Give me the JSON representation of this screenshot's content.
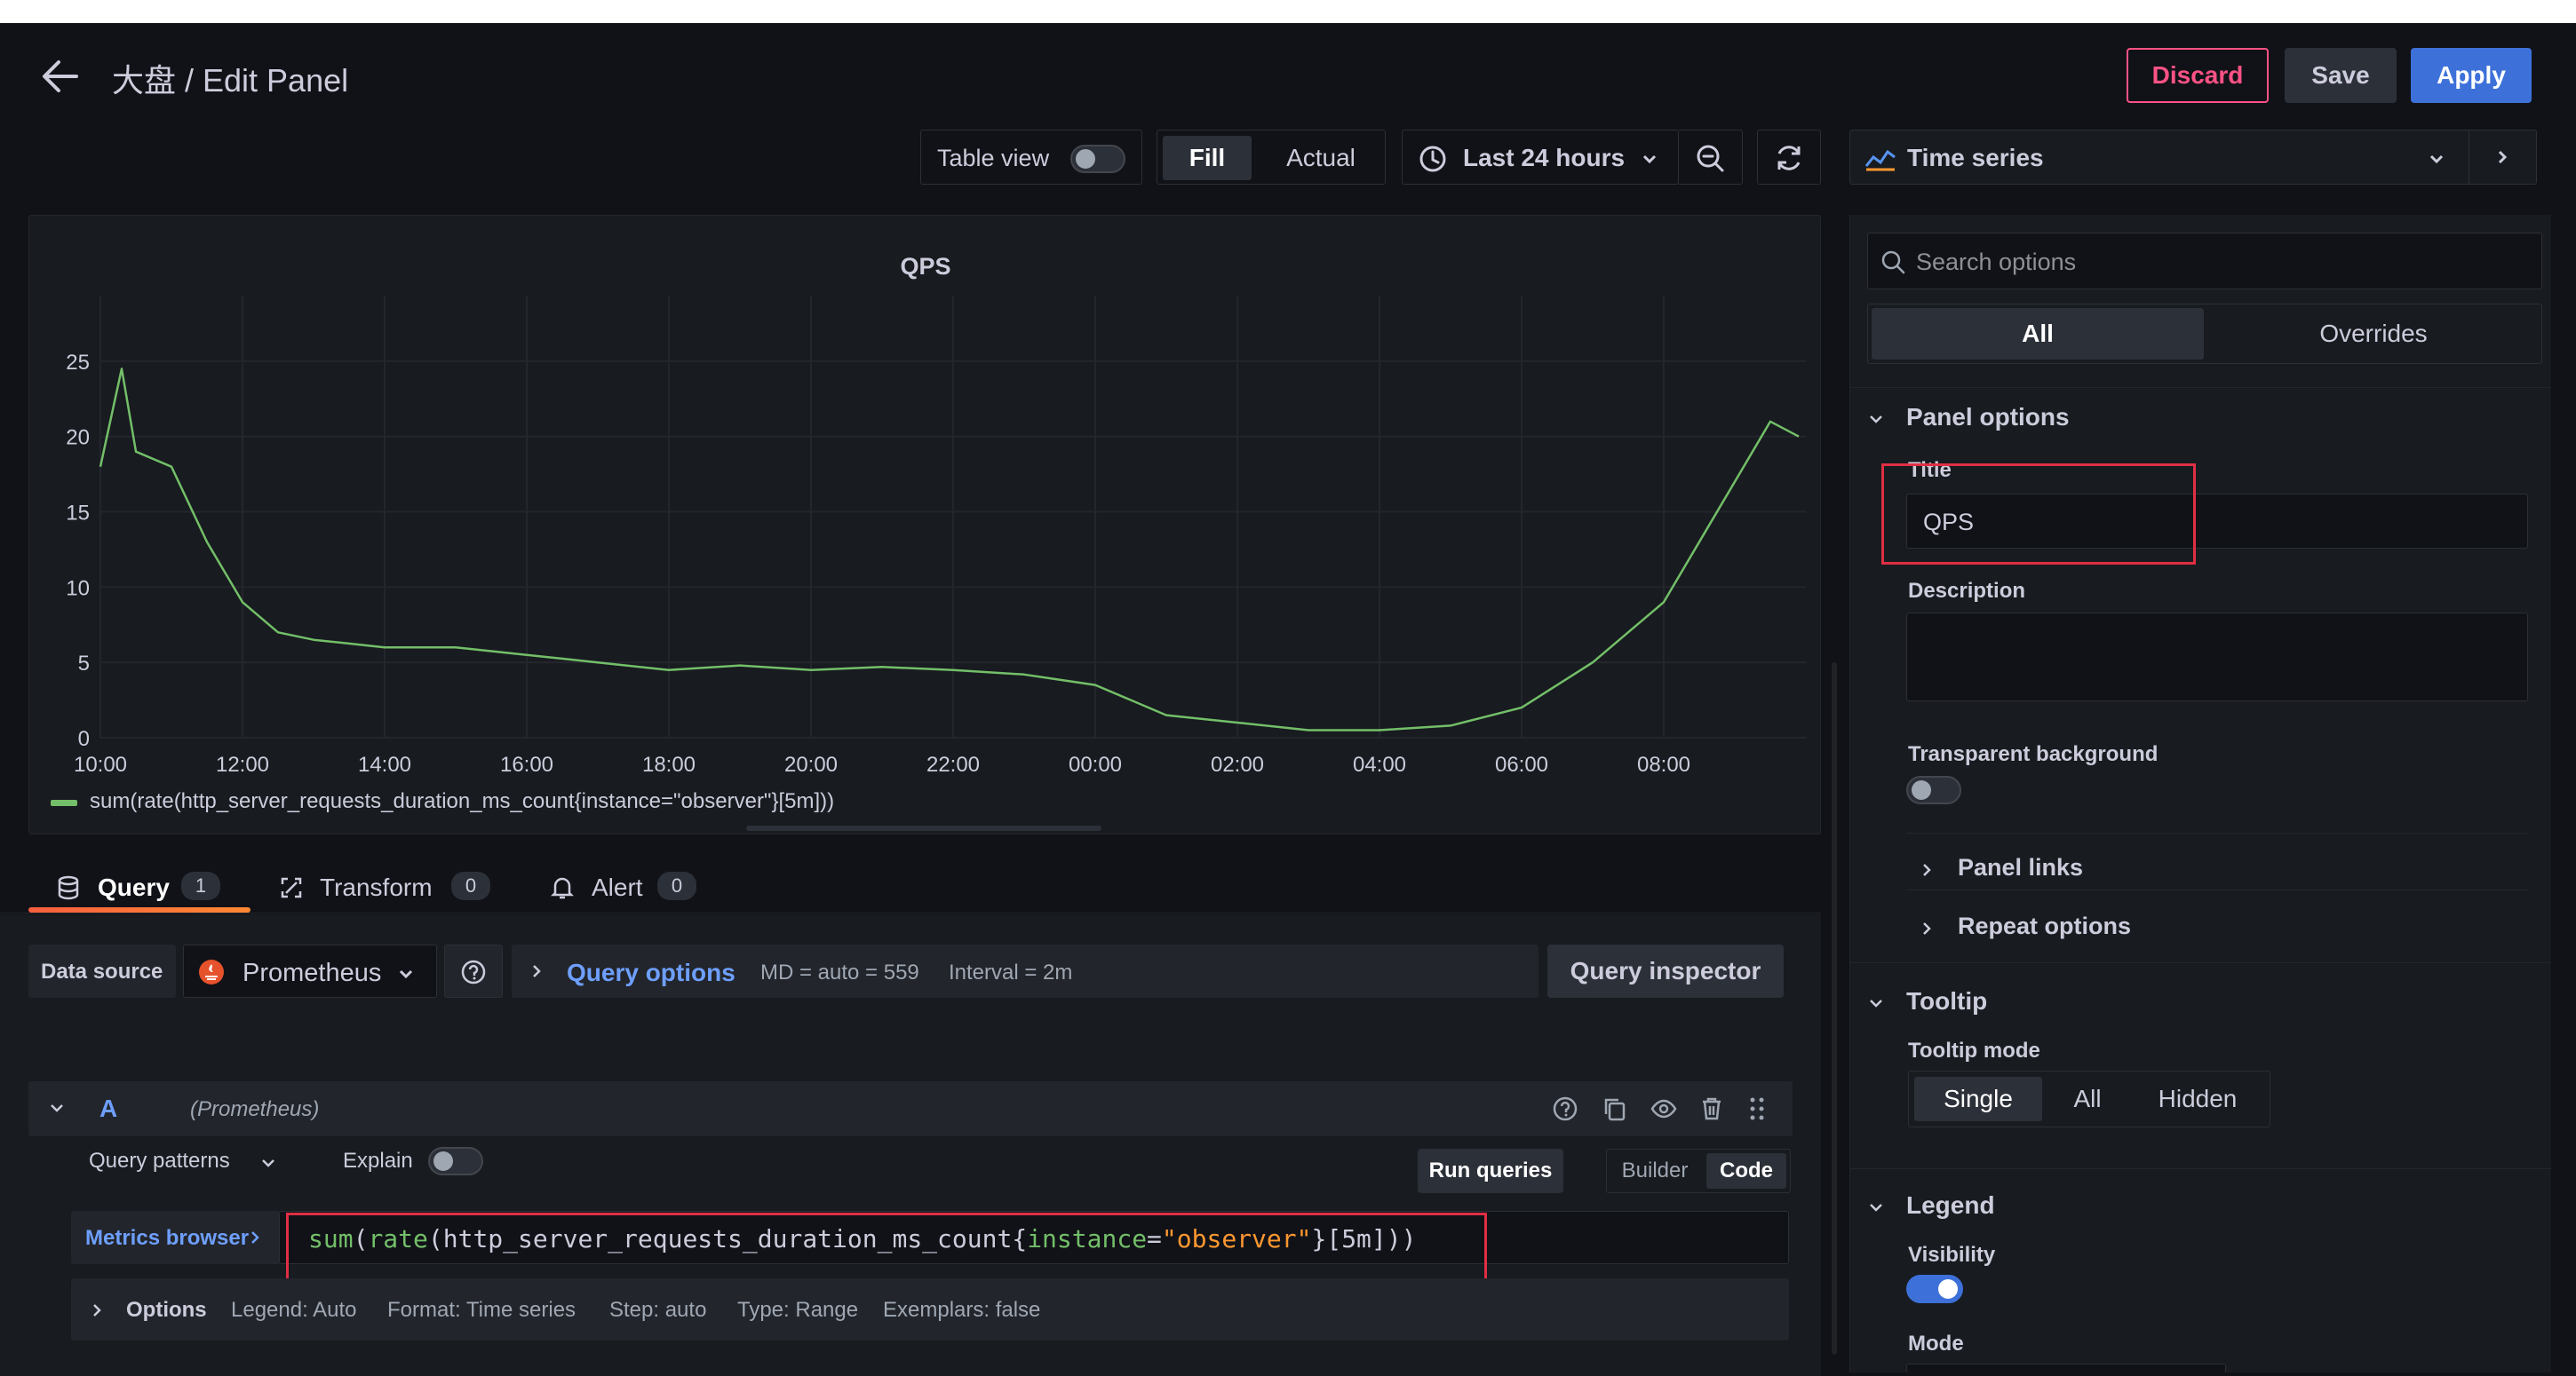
{
  "header": {
    "back_label": "←",
    "title": "大盘 / Edit Panel",
    "discard_label": "Discard",
    "save_label": "Save",
    "apply_label": "Apply"
  },
  "toolbar": {
    "table_view_label": "Table view",
    "fill_label": "Fill",
    "actual_label": "Actual",
    "time_range": "Last 24 hours",
    "visualization": "Time series"
  },
  "chart_data": {
    "type": "line",
    "title": "QPS",
    "xlabel": "",
    "ylabel": "",
    "ylim": [
      0,
      27
    ],
    "y_ticks": [
      0,
      5,
      10,
      15,
      20,
      25
    ],
    "x_tick_labels": [
      "10:00",
      "12:00",
      "14:00",
      "16:00",
      "18:00",
      "20:00",
      "22:00",
      "00:00",
      "02:00",
      "04:00",
      "06:00",
      "08:00"
    ],
    "x_hours_since_start": [
      0.0,
      0.3,
      0.5,
      1.0,
      1.5,
      2.0,
      2.5,
      3.0,
      4.0,
      5.0,
      6.0,
      7.0,
      8.0,
      9.0,
      10.0,
      11.0,
      12.0,
      13.0,
      14.0,
      15.0,
      16.0,
      17.0,
      18.0,
      19.0,
      20.0,
      21.0,
      22.0,
      23.0,
      23.5,
      23.9
    ],
    "series": [
      {
        "name": "sum(rate(http_server_requests_duration_ms_count{instance=\"observer\"}[5m]))",
        "color": "#73bf69",
        "values": [
          18,
          24.5,
          19,
          18,
          13,
          9,
          7,
          6.5,
          6,
          6,
          5.5,
          5,
          4.5,
          4.8,
          4.5,
          4.7,
          4.5,
          4.2,
          3.5,
          1.5,
          1.0,
          0.5,
          0.5,
          0.8,
          2.0,
          5.0,
          9.0,
          17.0,
          21.0,
          20.0
        ]
      }
    ],
    "legend": "bottom-left",
    "grid": true
  },
  "query_tabs": [
    {
      "label": "Query",
      "count": "1"
    },
    {
      "label": "Transform",
      "count": "0"
    },
    {
      "label": "Alert",
      "count": "0"
    }
  ],
  "datasource": {
    "label": "Data source",
    "name": "Prometheus",
    "query_options_label": "Query options",
    "md": "MD = auto = 559",
    "interval": "Interval = 2m",
    "inspector_label": "Query inspector"
  },
  "query": {
    "ref": "A",
    "ds": "(Prometheus)",
    "patterns_label": "Query patterns",
    "explain_label": "Explain",
    "run_label": "Run queries",
    "builder_label": "Builder",
    "code_label": "Code",
    "metrics_browser_label": "Metrics browser",
    "code_fn1": "sum",
    "code_p1": "(",
    "code_fn2": "rate",
    "code_p2": "(",
    "code_metric": "http_server_requests_duration_ms_count",
    "code_b1": "{",
    "code_lbl": "instance",
    "code_eq": "=",
    "code_val": "\"observer\"",
    "code_tail": "}[5m]))",
    "options_label": "Options",
    "opt_legend": "Legend: Auto",
    "opt_format": "Format: Time series",
    "opt_step": "Step: auto",
    "opt_type": "Type: Range",
    "opt_exemplars": "Exemplars: false"
  },
  "options_pane": {
    "search_placeholder": "Search options",
    "all_label": "All",
    "overrides_label": "Overrides",
    "panel_options": "Panel options",
    "title_label": "Title",
    "title_value": "QPS",
    "description_label": "Description",
    "transparent_label": "Transparent background",
    "panel_links": "Panel links",
    "repeat_options": "Repeat options",
    "tooltip": "Tooltip",
    "tooltip_mode_label": "Tooltip mode",
    "tooltip_single": "Single",
    "tooltip_all": "All",
    "tooltip_hidden": "Hidden",
    "legend": "Legend",
    "visibility_label": "Visibility",
    "mode_label": "Mode"
  },
  "colors": {
    "accent": "#3d71d9",
    "discard": "#ff5286",
    "series": "#73bf69",
    "highlight": "#e02f44"
  }
}
